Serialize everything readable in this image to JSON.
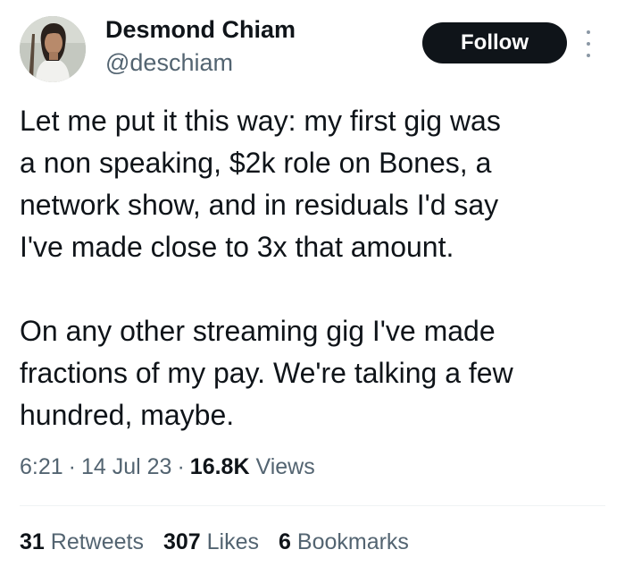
{
  "author": {
    "display_name": "Desmond Chiam",
    "handle": "@deschiam"
  },
  "follow_button": {
    "label": "Follow"
  },
  "more_menu": {
    "icon": "more-vertical-icon"
  },
  "tweet": {
    "paragraph1_lines": [
      "Let me put it this way: my first gig was",
      "a non speaking, $2k role on Bones, a",
      "network show, and in residuals I'd say",
      "I've made close to 3x that amount."
    ],
    "paragraph2_lines": [
      "On any other streaming gig I've made",
      "fractions of my pay. We're talking a few",
      "hundred, maybe."
    ]
  },
  "meta": {
    "time": "6:21",
    "separator": "·",
    "date": "14 Jul 23",
    "views_count": "16.8K",
    "views_label": "Views"
  },
  "stats": {
    "retweets_count": "31",
    "retweets_label": "Retweets",
    "likes_count": "307",
    "likes_label": "Likes",
    "bookmarks_count": "6",
    "bookmarks_label": "Bookmarks"
  },
  "colors": {
    "primary_text": "#0f1419",
    "secondary_text": "#536471",
    "button_bg": "#0f1419",
    "button_text": "#ffffff",
    "divider": "#eff3f4"
  }
}
